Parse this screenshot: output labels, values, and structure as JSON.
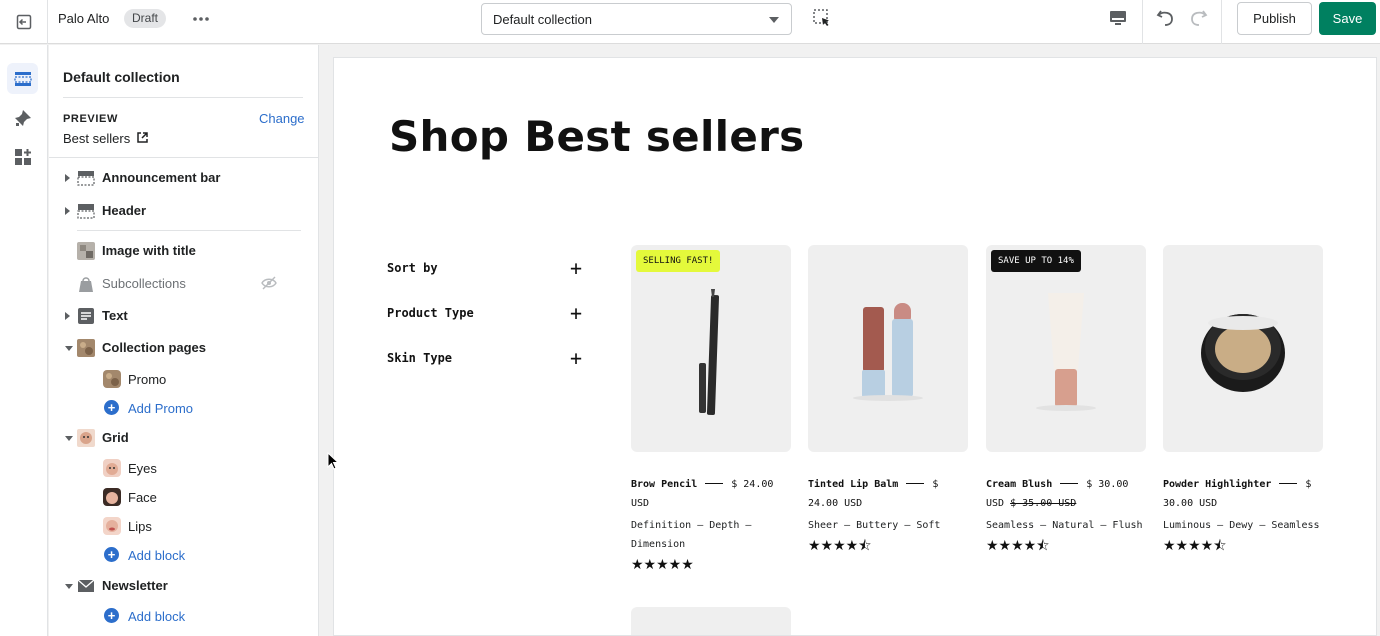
{
  "topbar": {
    "store_name": "Palo Alto",
    "draft_label": "Draft",
    "collection_select": "Default collection",
    "publish_label": "Publish",
    "save_label": "Save"
  },
  "sidebar": {
    "title": "Default collection",
    "preview_label": "PREVIEW",
    "change_label": "Change",
    "preview_value": "Best sellers",
    "sections": [
      {
        "label": "Announcement bar"
      },
      {
        "label": "Header"
      },
      {
        "label": "Image with title"
      },
      {
        "label": "Subcollections"
      },
      {
        "label": "Text"
      },
      {
        "label": "Collection pages"
      },
      {
        "label": "Grid"
      },
      {
        "label": "Newsletter"
      }
    ],
    "collection_children": [
      {
        "label": "Promo"
      },
      {
        "label": "Add Promo"
      }
    ],
    "grid_children": [
      {
        "label": "Eyes"
      },
      {
        "label": "Face"
      },
      {
        "label": "Lips"
      },
      {
        "label": "Add block"
      }
    ],
    "newsletter_children": [
      {
        "label": "Add block"
      }
    ]
  },
  "preview": {
    "title": "Shop Best sellers",
    "filters": [
      "Sort by",
      "Product Type",
      "Skin Type"
    ],
    "filter_plus": "+",
    "products": [
      {
        "badge": "SELLING FAST!",
        "name": "Brow Pencil",
        "price_line1": "$ 24.00",
        "price_line2": "USD",
        "compare": "",
        "desc": "Definition — Depth — Dimension",
        "rating": "★★★★★"
      },
      {
        "badge": "",
        "name": "Tinted Lip Balm",
        "price_line1": "$",
        "price_line2": "24.00 USD",
        "compare": "",
        "desc": "Sheer — Buttery — Soft",
        "rating": "★★★★⯪"
      },
      {
        "badge": "SAVE UP TO 14%",
        "name": "Cream Blush",
        "price_line1": "$ 30.00",
        "price_line2": "USD",
        "compare": "$ 35.00 USD",
        "desc": "Seamless — Natural — Flush",
        "rating": "★★★★⯪"
      },
      {
        "badge": "",
        "name": "Powder Highlighter",
        "price_line1": "$",
        "price_line2": "30.00 USD",
        "compare": "",
        "desc": "Luminous — Dewy — Seamless",
        "rating": "★★★★⯪"
      }
    ]
  },
  "colors": {
    "accent": "#2c6ecb",
    "save": "#008060",
    "badge_yellow": "#e4f93b",
    "badge_black": "#111111"
  }
}
